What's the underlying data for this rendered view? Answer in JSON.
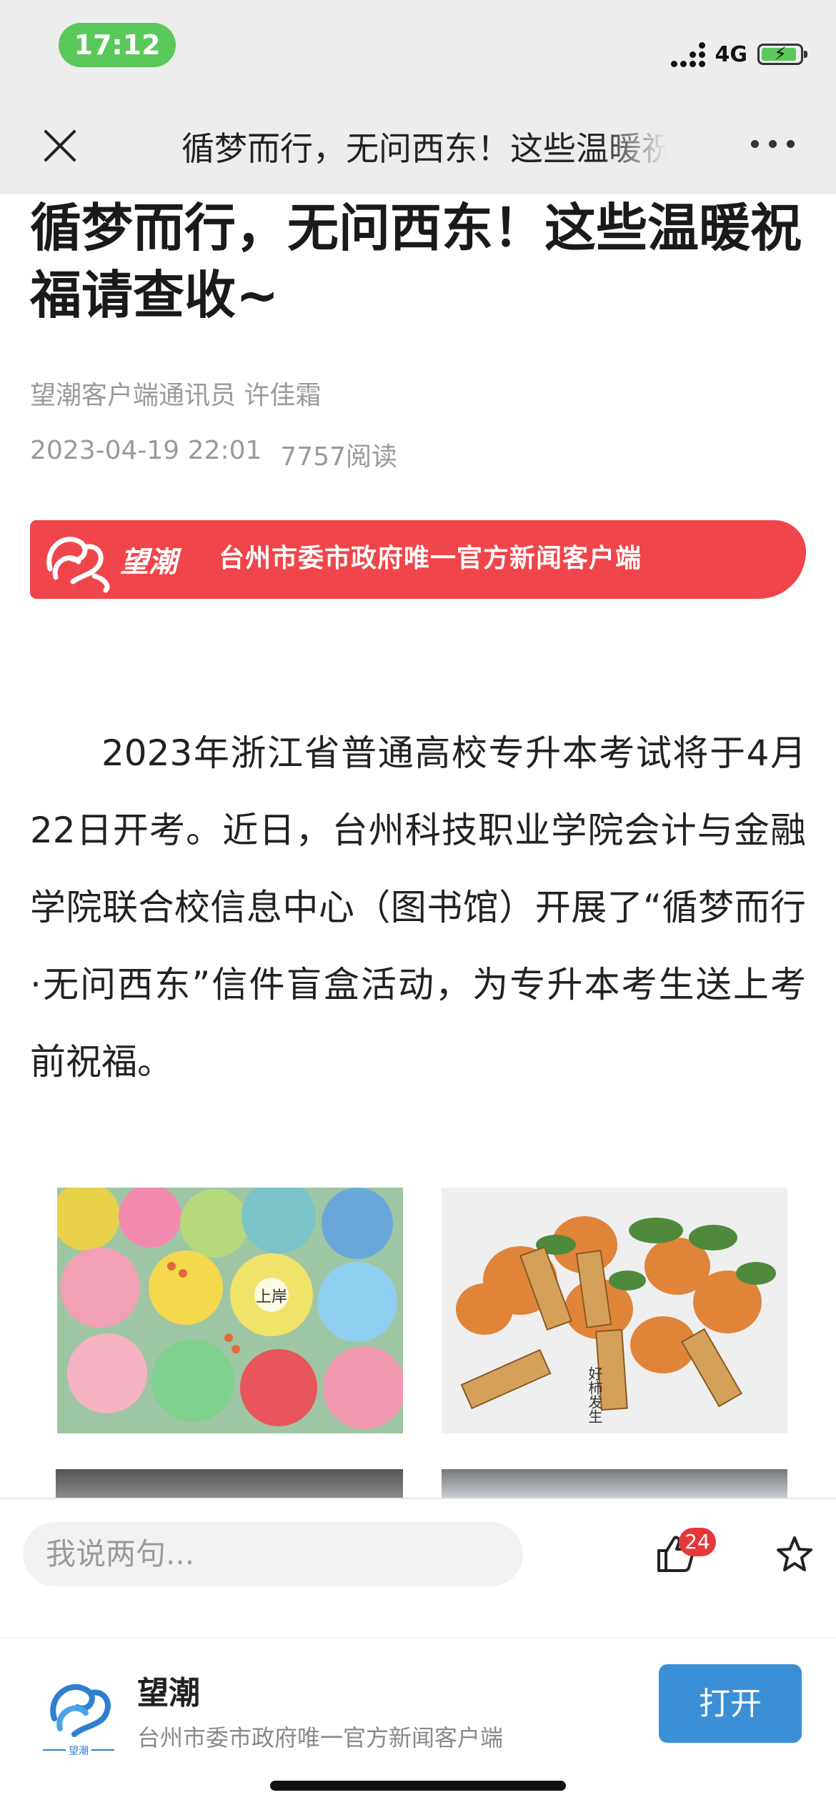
{
  "status_bar": {
    "time": "17:12",
    "network": "4G"
  },
  "nav": {
    "title": "循梦而行，无问西东！这些温暖祝福请查收~"
  },
  "article": {
    "headline": "循梦而行，无问西东！这些温暖祝福请查收~",
    "byline": "望潮客户端通讯员  许佳霜",
    "datetime": "2023-04-19 22:01",
    "reads": "7757阅读",
    "banner_text": "台州市委市政府唯一官方新闻客户端",
    "body": "2023年浙江省普通高校专升本考试将于4月22日开考。近日，台州科技职业学院会计与金融学院联合校信息中心（图书馆）开展了“循梦而行·无问西东”信件盲盒活动，为专升本考生送上考前祝福。"
  },
  "comment_bar": {
    "placeholder": "我说两句...",
    "like_count": "24"
  },
  "promo": {
    "app_name": "望潮",
    "app_desc": "台州市委市政府唯一官方新闻客户端",
    "open_label": "打开",
    "icon_caption": "望潮"
  },
  "banner_logo_text": "望潮",
  "photos": [
    {
      "name": "clay-badges-photo",
      "stamp_text": "上岸"
    },
    {
      "name": "knitted-oranges-photo",
      "tag_text": "好柿发生"
    }
  ],
  "colors": {
    "brand_red": "#f0454a",
    "open_blue": "#3b8fd6",
    "status_green": "#5ac85a",
    "badge_red": "#e5383b"
  }
}
